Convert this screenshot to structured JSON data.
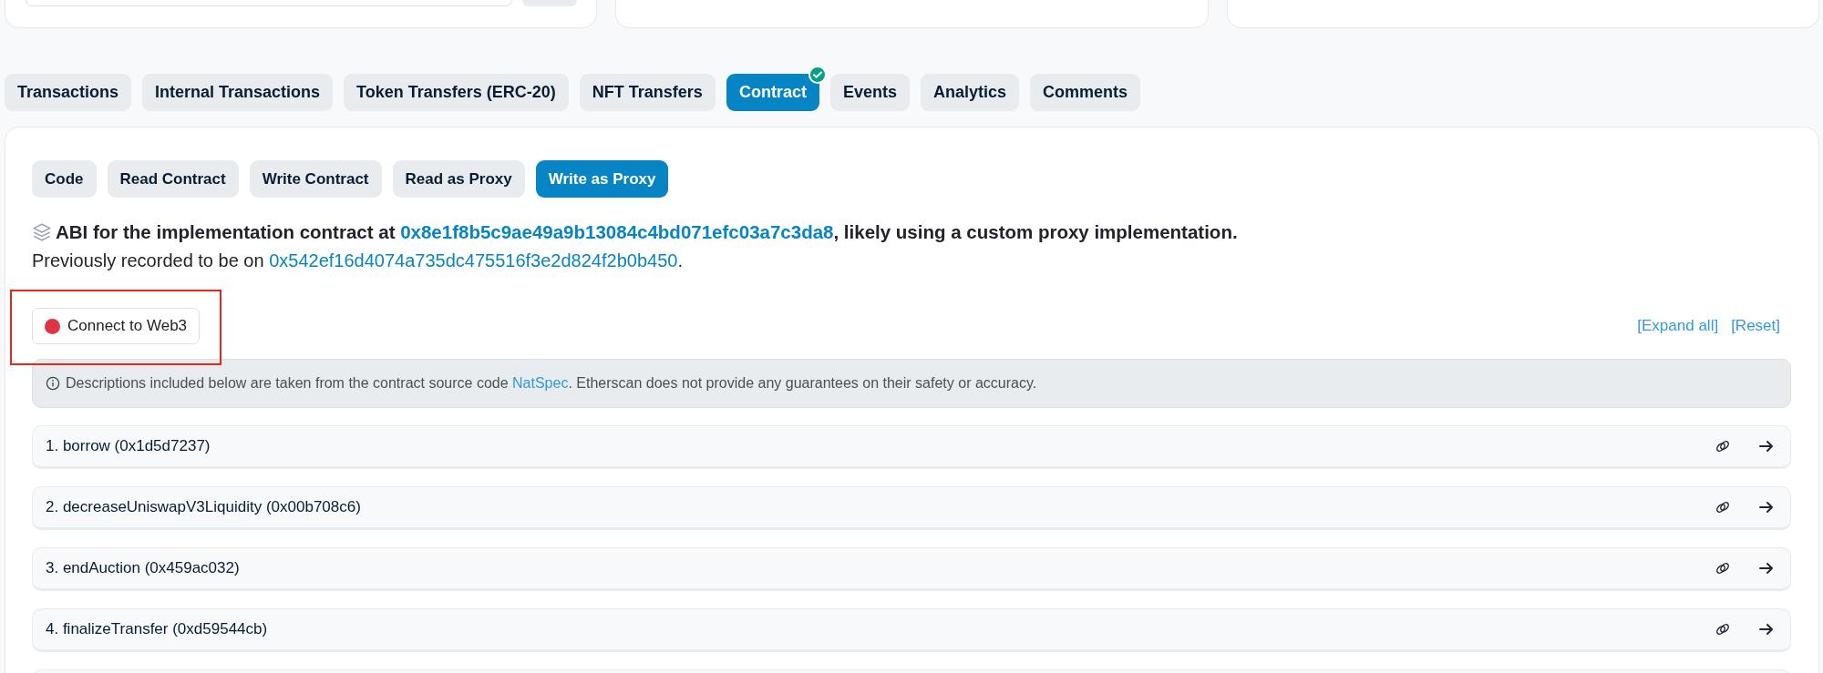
{
  "tabs": [
    {
      "label": "Transactions",
      "selected": false,
      "verified": false
    },
    {
      "label": "Internal Transactions",
      "selected": false,
      "verified": false
    },
    {
      "label": "Token Transfers (ERC-20)",
      "selected": false,
      "verified": false
    },
    {
      "label": "NFT Transfers",
      "selected": false,
      "verified": false
    },
    {
      "label": "Contract",
      "selected": true,
      "verified": true
    },
    {
      "label": "Events",
      "selected": false,
      "verified": false
    },
    {
      "label": "Analytics",
      "selected": false,
      "verified": false
    },
    {
      "label": "Comments",
      "selected": false,
      "verified": false
    }
  ],
  "subtabs": [
    {
      "label": "Code",
      "selected": false
    },
    {
      "label": "Read Contract",
      "selected": false
    },
    {
      "label": "Write Contract",
      "selected": false
    },
    {
      "label": "Read as Proxy",
      "selected": false
    },
    {
      "label": "Write as Proxy",
      "selected": true
    }
  ],
  "abi_note": {
    "prefix": "ABI for the implementation contract at",
    "address": "0x8e1f8b5c9ae49a9b13084c4bd071efc03a7c3da8",
    "suffix": ", likely using a custom proxy implementation."
  },
  "previous_note": {
    "prefix": "Previously recorded to be on",
    "address": "0x542ef16d4074a735dc475516f3e2d824f2b0b450",
    "suffix": "."
  },
  "connect_button": {
    "label": "Connect to Web3",
    "connected": false,
    "highlighted": true
  },
  "actions": [
    "[Expand all]",
    "[Reset]"
  ],
  "notice": {
    "prefix": "Descriptions included below are taken from the contract source code",
    "link": "NatSpec",
    "suffix": ". Etherscan does not provide any guarantees on their safety or accuracy."
  },
  "functions": [
    {
      "label": "1. borrow (0x1d5d7237)"
    },
    {
      "label": "2. decreaseUniswapV3Liquidity (0x00b708c6)"
    },
    {
      "label": "3. endAuction (0x459ac032)"
    },
    {
      "label": "4. finalizeTransfer (0xd59544cb)"
    }
  ]
}
